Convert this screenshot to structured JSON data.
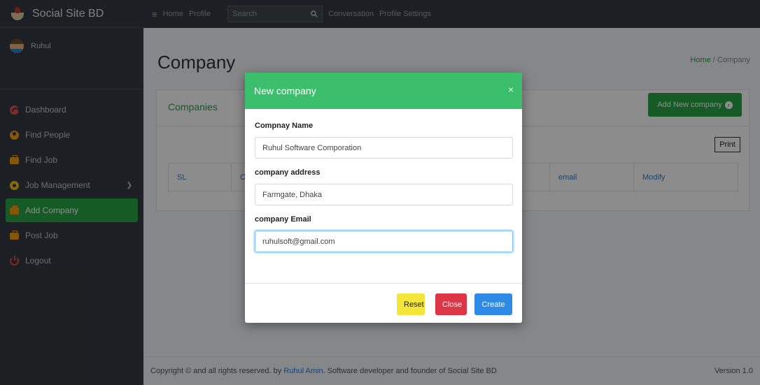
{
  "brand": {
    "name": "Social Site BD"
  },
  "user": {
    "name": "Ruhul"
  },
  "sidebar": {
    "items": [
      {
        "label": "Dashboard",
        "icon": "dashboard-icon"
      },
      {
        "label": "Find People",
        "icon": "user-icon"
      },
      {
        "label": "Find Job",
        "icon": "briefcase-icon"
      },
      {
        "label": "Job Management",
        "icon": "gear-icon"
      },
      {
        "label": "Add Company",
        "icon": "briefcase-icon"
      },
      {
        "label": "Post Job",
        "icon": "briefcase-icon"
      },
      {
        "label": "Logout",
        "icon": "power-icon"
      }
    ],
    "active_index": 4,
    "accent": "#28a745"
  },
  "topbar": {
    "hamburger": "≡",
    "links": [
      "Home",
      "Profile",
      "Conversation",
      "Profile Settings"
    ],
    "search_placeholder": "Search"
  },
  "page": {
    "title": "Company",
    "breadcrumb_home": "Home",
    "breadcrumb_sep": " / ",
    "breadcrumb_current": "Company"
  },
  "card": {
    "title": "Companies",
    "add_button": "Add New company",
    "print_button": "Print",
    "columns": [
      "SL",
      "Co",
      "",
      "",
      "email",
      "Modify"
    ]
  },
  "modal": {
    "title": "New company",
    "close_glyph": "×",
    "fields": [
      {
        "label": "Compnay Name",
        "value": "Ruhul Software Comporation"
      },
      {
        "label": "company address",
        "value": "Farmgate, Dhaka"
      },
      {
        "label": "company Email",
        "value": "ruhulsoft@gmail.com"
      }
    ],
    "buttons": {
      "reset": "Reset",
      "close": "Close",
      "create": "Create"
    },
    "header_color": "#3cbf6c"
  },
  "footer": {
    "text_before": "Copyright © and all rights reserved. by ",
    "author": "Ruhul Amin",
    "text_after": ". Software developer and founder of Social Site BD",
    "version": "Version 1.0"
  }
}
